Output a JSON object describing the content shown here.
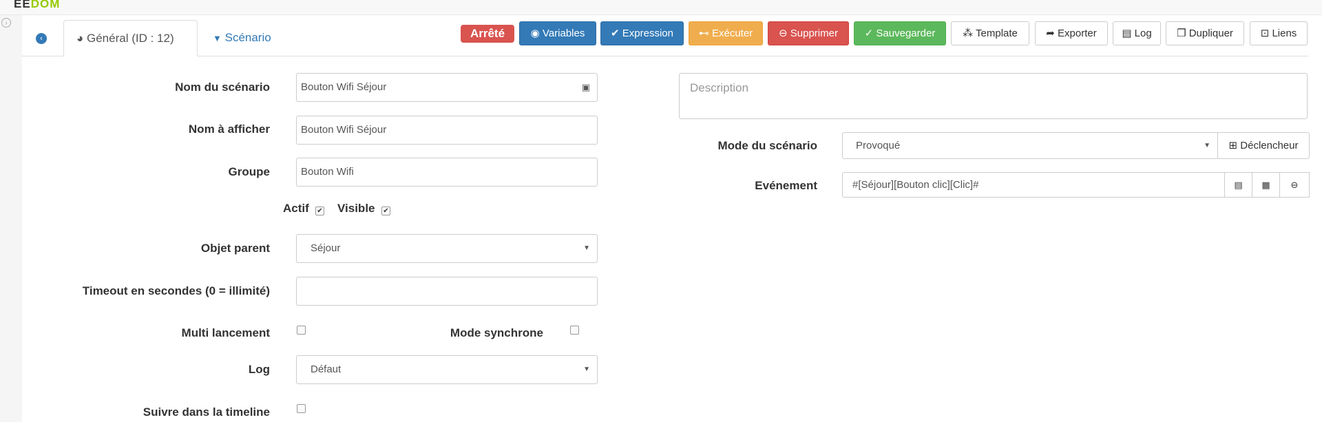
{
  "app": {
    "logo_prefix": "EE",
    "logo_suffix": "DOM"
  },
  "tabs": [
    {
      "label": "Général (ID : 12)",
      "icon": "dashboard-icon"
    },
    {
      "label": "Scénario",
      "icon": "filter-icon"
    }
  ],
  "status": "Arrêté",
  "toolbar": {
    "variables": "Variables",
    "expression": "Expression",
    "executer": "Exécuter",
    "supprimer": "Supprimer",
    "sauvegarder": "Sauvegarder",
    "template": "Template",
    "exporter": "Exporter",
    "log": "Log",
    "dupliquer": "Dupliquer",
    "liens": "Liens"
  },
  "colors": {
    "primary": "#337ab7",
    "warning": "#f0ad4e",
    "danger": "#d9534f",
    "success": "#5cb85c"
  },
  "form": {
    "name_label": "Nom du scénario",
    "name_value": "Bouton Wifi Séjour",
    "display_label": "Nom à afficher",
    "display_value": "Bouton Wifi Séjour",
    "group_label": "Groupe",
    "group_value": "Bouton Wifi",
    "actif_label": "Actif",
    "actif_checked": true,
    "visible_label": "Visible",
    "visible_checked": true,
    "parent_label": "Objet parent",
    "parent_value": "Séjour",
    "timeout_label": "Timeout en secondes (0 = illimité)",
    "timeout_value": "",
    "multi_label": "Multi lancement",
    "multi_checked": false,
    "sync_label": "Mode synchrone",
    "sync_checked": false,
    "log_label": "Log",
    "log_value": "Défaut",
    "timeline_label": "Suivre dans la timeline",
    "timeline_checked": false,
    "description_placeholder": "Description",
    "mode_label": "Mode du scénario",
    "mode_value": "Provoqué",
    "trigger_button": "Déclencheur",
    "event_label": "Evénement",
    "event_value": "#[Séjour][Bouton clic][Clic]#"
  }
}
